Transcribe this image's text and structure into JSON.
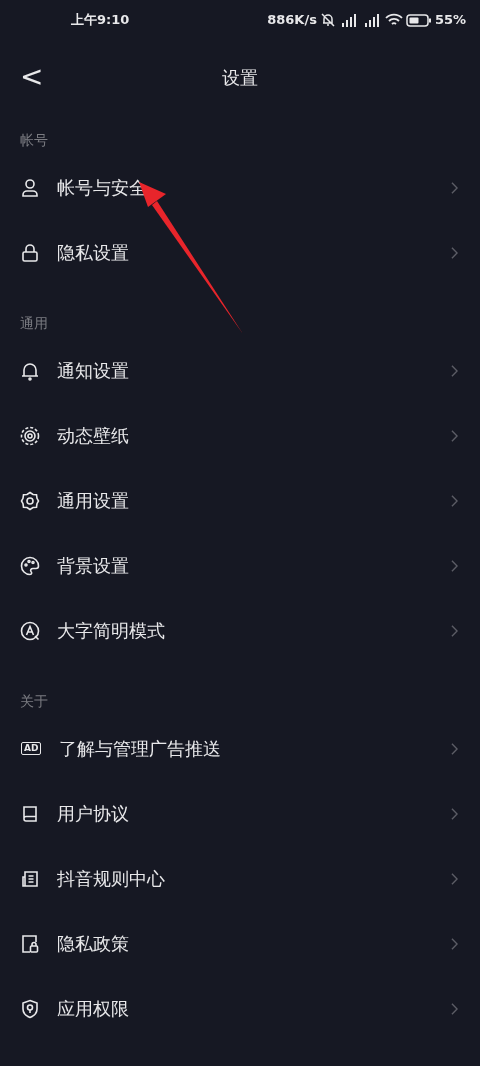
{
  "status_bar": {
    "time": "上午9:10",
    "speed": "886K/s",
    "battery_percent": "55%"
  },
  "nav": {
    "back": "<",
    "title": "设置"
  },
  "sections": [
    {
      "title": "帐号",
      "items": [
        {
          "label": "帐号与安全"
        },
        {
          "label": "隐私设置"
        }
      ]
    },
    {
      "title": "通用",
      "items": [
        {
          "label": "通知设置"
        },
        {
          "label": "动态壁纸"
        },
        {
          "label": "通用设置"
        },
        {
          "label": "背景设置"
        },
        {
          "label": "大字简明模式"
        }
      ]
    },
    {
      "title": "关于",
      "items": [
        {
          "badge": "AD",
          "label": "了解与管理广告推送"
        },
        {
          "label": "用户协议"
        },
        {
          "label": "抖音规则中心"
        },
        {
          "label": "隐私政策"
        },
        {
          "label": "应用权限"
        }
      ]
    }
  ],
  "annotation": {
    "kind": "arrow",
    "color": "#e8252b"
  }
}
